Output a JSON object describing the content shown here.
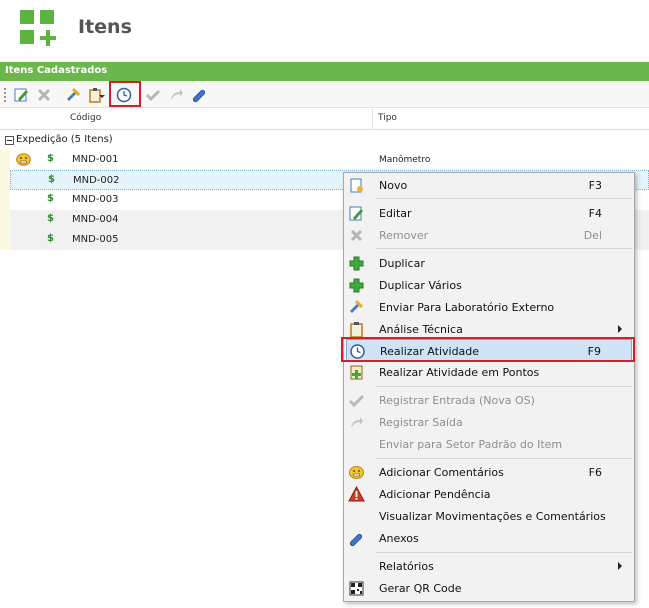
{
  "header": {
    "title": "Itens"
  },
  "panel": {
    "title": "Itens Cadastrados"
  },
  "toolbar": {
    "buttons": [
      "edit-icon",
      "remove-icon",
      "send-lab-icon",
      "clipboard-icon",
      "realizar-atividade-icon",
      "register-entry-icon",
      "register-exit-icon",
      "attachment-icon"
    ]
  },
  "grid": {
    "columns": {
      "codigo": "Código",
      "tipo": "Tipo"
    },
    "group_label": "Expedição (5 Itens)",
    "rows": [
      {
        "code": "MND-001",
        "tipo": "Manômetro",
        "symbol": "$"
      },
      {
        "code": "MND-002",
        "tipo": "",
        "symbol": "$"
      },
      {
        "code": "MND-003",
        "tipo": "",
        "symbol": "$"
      },
      {
        "code": "MND-004",
        "tipo": "",
        "symbol": "$"
      },
      {
        "code": "MND-005",
        "tipo": "",
        "symbol": "$"
      }
    ]
  },
  "context_menu": {
    "items": [
      {
        "label": "Novo",
        "shortcut": "F3",
        "icon": "new-doc-icon"
      },
      {
        "label": "Editar",
        "shortcut": "F4",
        "icon": "edit-icon"
      },
      {
        "label": "Remover",
        "shortcut": "Del",
        "icon": "remove-icon",
        "disabled": true
      },
      {
        "label": "Duplicar",
        "icon": "duplicate-icon"
      },
      {
        "label": "Duplicar Vários",
        "icon": "duplicate-many-icon"
      },
      {
        "label": "Enviar Para Laboratório Externo",
        "icon": "send-lab-icon"
      },
      {
        "label": "Análise Técnica",
        "icon": "clipboard-icon",
        "submenu": true
      },
      {
        "label": "Realizar Atividade",
        "shortcut": "F9",
        "icon": "clock-icon",
        "highlighted": true
      },
      {
        "label": "Realizar Atividade em Pontos",
        "icon": "points-icon"
      },
      {
        "label": "Registrar Entrada (Nova OS)",
        "icon": "register-entry-icon",
        "disabled": true
      },
      {
        "label": "Registrar Saída",
        "icon": "register-exit-icon",
        "disabled": true
      },
      {
        "label": "Enviar para Setor Padrão do Item",
        "disabled": true
      },
      {
        "label": "Adicionar Comentários",
        "shortcut": "F6",
        "icon": "comment-icon"
      },
      {
        "label": "Adicionar Pendência",
        "icon": "warning-icon"
      },
      {
        "label": "Visualizar Movimentações e Comentários"
      },
      {
        "label": "Anexos",
        "icon": "attachment-icon"
      },
      {
        "label": "Relatórios",
        "submenu": true
      },
      {
        "label": "Gerar QR Code",
        "icon": "qr-code-icon"
      }
    ]
  },
  "colors": {
    "brand_green": "#6ab84a",
    "highlight_red": "#d0202a",
    "selection_blue": "#cfe3f7"
  }
}
